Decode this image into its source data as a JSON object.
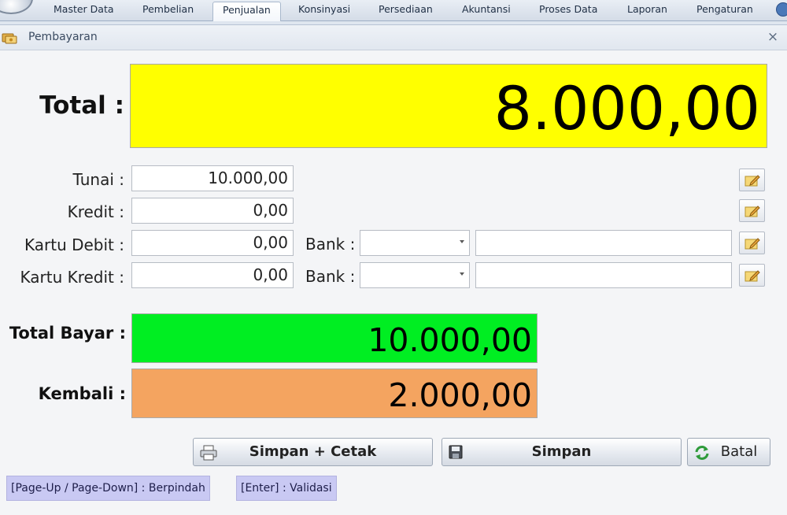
{
  "menu": {
    "items": [
      {
        "label": "Master Data"
      },
      {
        "label": "Pembelian"
      },
      {
        "label": "Penjualan"
      },
      {
        "label": "Konsinyasi"
      },
      {
        "label": "Persediaan"
      },
      {
        "label": "Akuntansi"
      },
      {
        "label": "Proses Data"
      },
      {
        "label": "Laporan"
      },
      {
        "label": "Pengaturan"
      }
    ],
    "active": "Penjualan"
  },
  "dialog": {
    "title": "Pembayaran",
    "close_label": "×"
  },
  "total": {
    "label": "Total :",
    "value": "8.000,00",
    "color": "#ffff00"
  },
  "payments": {
    "tunai": {
      "label": "Tunai :",
      "value": "10.000,00"
    },
    "kredit": {
      "label": "Kredit :",
      "value": "0,00"
    },
    "kartu_debit": {
      "label": "Kartu Debit :",
      "value": "0,00",
      "bank_label": "Bank :",
      "bank_value": "",
      "bank_note": ""
    },
    "kartu_kredit": {
      "label": "Kartu Kredit :",
      "value": "0,00",
      "bank_label": "Bank :",
      "bank_value": "",
      "bank_note": ""
    }
  },
  "summary": {
    "total_bayar": {
      "label": "Total Bayar :",
      "value": "10.000,00",
      "color": "#00ee22"
    },
    "kembali": {
      "label": "Kembali :",
      "value": "2.000,00",
      "color": "#f4a460"
    }
  },
  "buttons": {
    "simpan_cetak": {
      "label": "Simpan + Cetak",
      "icon": "printer-icon"
    },
    "simpan": {
      "label": "Simpan",
      "icon": "floppy-disk-icon"
    },
    "batal": {
      "label": "Batal",
      "icon": "refresh-icon"
    }
  },
  "hints": {
    "navigate": "[Page-Up / Page-Down] : Berpindah",
    "validate": "[Enter] : Validasi"
  }
}
